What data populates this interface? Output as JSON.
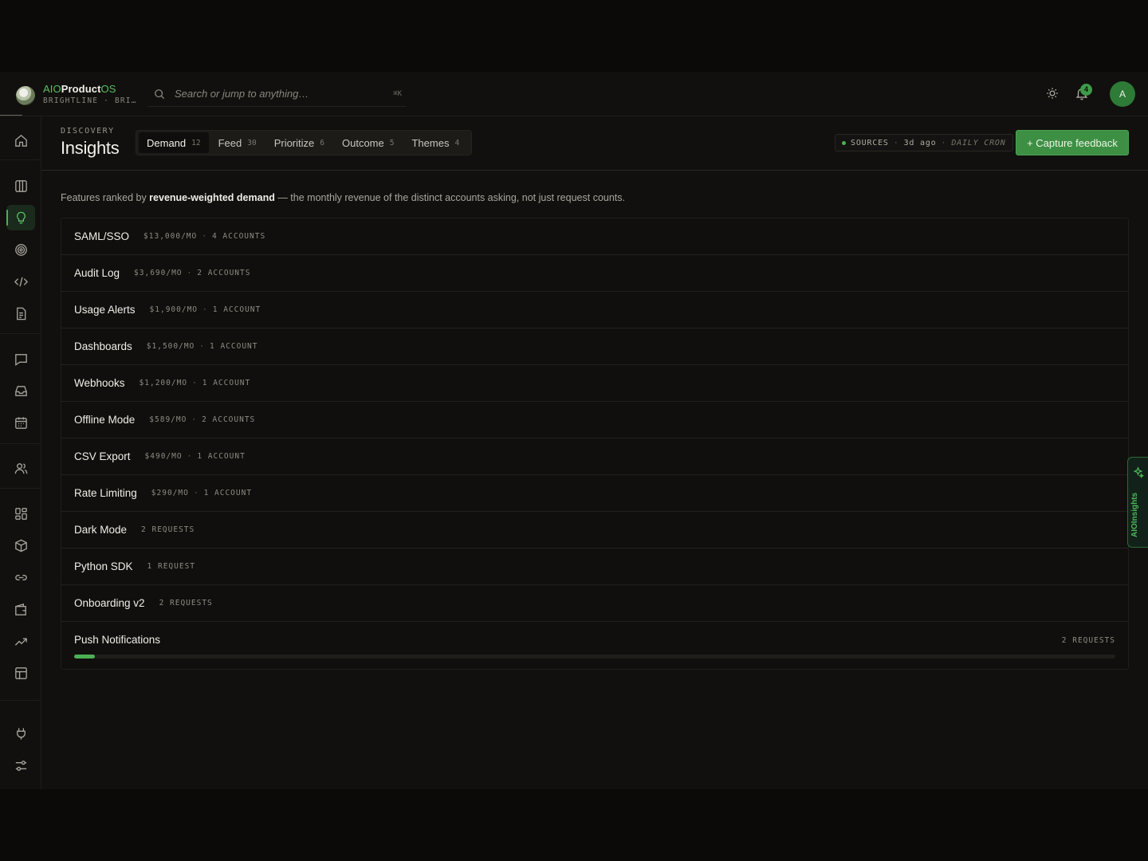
{
  "brand": {
    "prefix": "AIO",
    "product": "Product",
    "suffix": "OS",
    "subtitle": "BRIGHTLINE · BRI…"
  },
  "search": {
    "placeholder": "Search or jump to anything…",
    "shortcut": "⌘K"
  },
  "header": {
    "notification_count": "4",
    "avatar_initial": "A"
  },
  "sidebar": {
    "items": [
      {
        "name": "home",
        "icon": "home-icon"
      },
      {
        "name": "board",
        "icon": "columns-icon"
      },
      {
        "name": "insights",
        "icon": "lightbulb-icon",
        "active": true
      },
      {
        "name": "goals",
        "icon": "target-icon"
      },
      {
        "name": "code",
        "icon": "code-icon"
      },
      {
        "name": "docs",
        "icon": "document-icon"
      },
      {
        "name": "messages",
        "icon": "message-icon"
      },
      {
        "name": "inbox",
        "icon": "inbox-icon"
      },
      {
        "name": "calendar",
        "icon": "calendar-icon"
      },
      {
        "name": "people",
        "icon": "users-icon"
      },
      {
        "name": "widgets",
        "icon": "grid-icon"
      },
      {
        "name": "packages",
        "icon": "cube-icon"
      },
      {
        "name": "links",
        "icon": "link-icon"
      },
      {
        "name": "wallet",
        "icon": "wallet-icon"
      },
      {
        "name": "trends",
        "icon": "trending-up-icon"
      },
      {
        "name": "tables",
        "icon": "table-icon"
      },
      {
        "name": "integrations",
        "icon": "plug-icon"
      },
      {
        "name": "settings",
        "icon": "sliders-icon"
      }
    ]
  },
  "page": {
    "kicker": "DISCOVERY",
    "title": "Insights",
    "tabs": [
      {
        "label": "Demand",
        "count": "12",
        "active": true
      },
      {
        "label": "Feed",
        "count": "30"
      },
      {
        "label": "Prioritize",
        "count": "6"
      },
      {
        "label": "Outcome",
        "count": "5"
      },
      {
        "label": "Themes",
        "count": "4"
      }
    ],
    "sources": {
      "label": "SOURCES",
      "age": "3d ago",
      "schedule": "DAILY CRON"
    },
    "capture_button": "+ Capture feedback",
    "intro": {
      "before": "Features ranked by ",
      "bold": "revenue-weighted demand",
      "after": " — the monthly revenue of the distinct accounts asking, not just request counts."
    }
  },
  "features": [
    {
      "name": "SAML/SSO",
      "revenue": "$13,000/MO",
      "accounts": "4 ACCOUNTS"
    },
    {
      "name": "Audit Log",
      "revenue": "$3,690/MO",
      "accounts": "2 ACCOUNTS"
    },
    {
      "name": "Usage Alerts",
      "revenue": "$1,900/MO",
      "accounts": "1 ACCOUNT"
    },
    {
      "name": "Dashboards",
      "revenue": "$1,500/MO",
      "accounts": "1 ACCOUNT"
    },
    {
      "name": "Webhooks",
      "revenue": "$1,200/MO",
      "accounts": "1 ACCOUNT"
    },
    {
      "name": "Offline Mode",
      "revenue": "$589/MO",
      "accounts": "2 ACCOUNTS"
    },
    {
      "name": "CSV Export",
      "revenue": "$490/MO",
      "accounts": "1 ACCOUNT"
    },
    {
      "name": "Rate Limiting",
      "revenue": "$290/MO",
      "accounts": "1 ACCOUNT"
    },
    {
      "name": "Dark Mode",
      "requests": "2 REQUESTS"
    },
    {
      "name": "Python SDK",
      "requests": "1 REQUEST"
    },
    {
      "name": "Onboarding v2",
      "requests": "2 REQUESTS"
    },
    {
      "name": "Push Notifications",
      "requests": "2 REQUESTS",
      "bar_fraction": 0.02
    }
  ],
  "side_panel": {
    "label": "AIOInsights"
  },
  "colors": {
    "accent": "#4caf55",
    "button": "#3d8f44",
    "background": "#11100e"
  }
}
